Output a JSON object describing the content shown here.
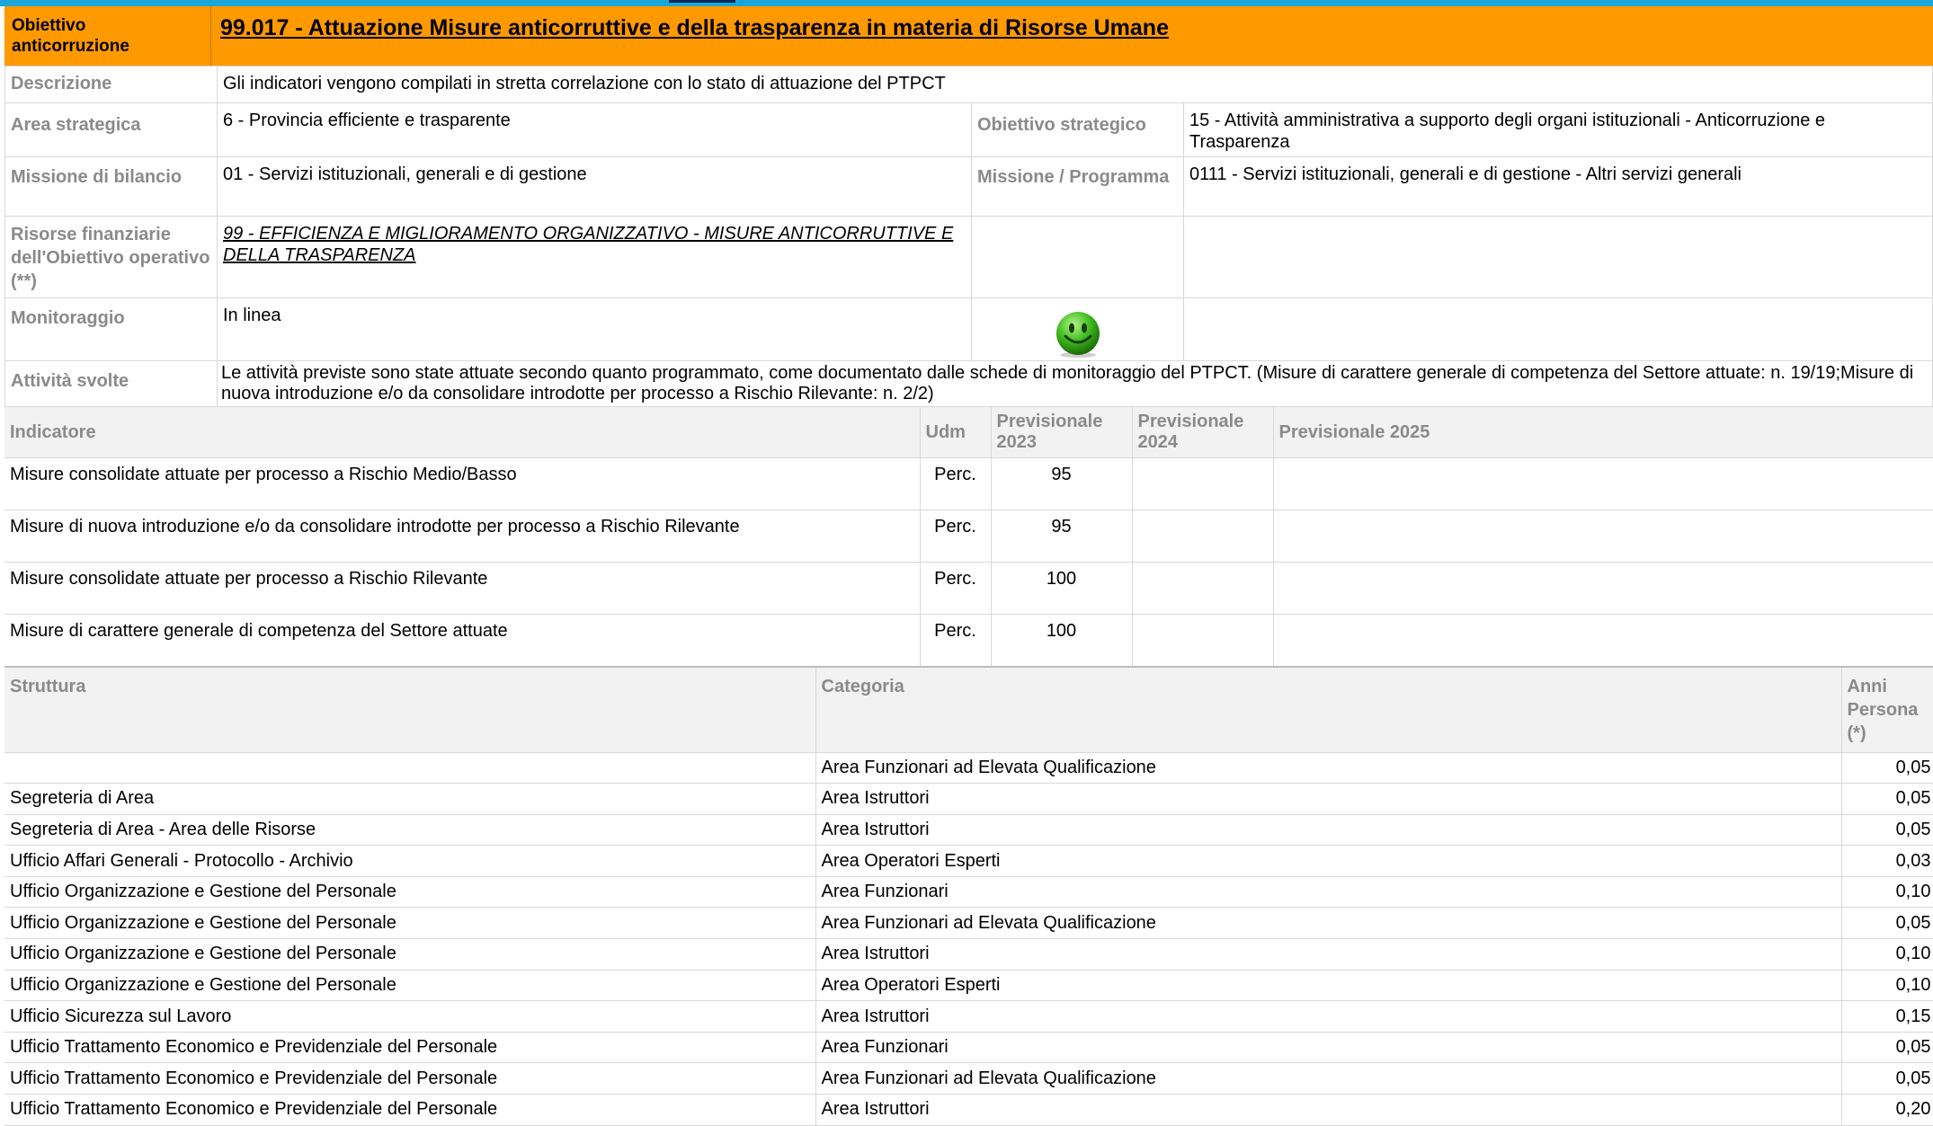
{
  "header": {
    "label": "Obiettivo anticorruzione",
    "title": "99.017 - Attuazione Misure anticorruttive e della trasparenza in materia di Risorse Umane"
  },
  "details": {
    "descrizione_label": "Descrizione",
    "descrizione_value": "Gli indicatori vengono compilati in stretta correlazione con lo stato di attuazione del PTPCT",
    "area_label": "Area strategica",
    "area_value": "6 - Provincia efficiente e trasparente",
    "obiettivo_strategico_label": "Obiettivo strategico",
    "obiettivo_strategico_value": "15 - Attività amministrativa a supporto degli organi istituzionali - Anticorruzione e Trasparenza",
    "missione_label": "Missione di bilancio",
    "missione_value": "01 - Servizi istituzionali, generali e di gestione",
    "missione_programma_label": "Missione / Programma",
    "missione_programma_value": "0111 - Servizi istituzionali, generali e di gestione - Altri servizi generali",
    "risorse_label": "Risorse finanziarie dell'Obiettivo operativo (**)",
    "risorse_value": "99 - EFFICIENZA E MIGLIORAMENTO ORGANIZZATIVO - MISURE ANTICORRUTTIVE E DELLA TRASPARENZA",
    "monitoraggio_label": "Monitoraggio",
    "monitoraggio_value": "In linea",
    "monitoraggio_icon": "smiley-green-icon",
    "attivita_label": "Attività svolte",
    "attivita_value": "Le attività previste sono state attuate secondo quanto programmato, come documentato dalle schede di monitoraggio del PTPCT. (Misure di carattere generale di competenza del Settore attuate: n. 19/19;Misure di nuova introduzione e/o da consolidare introdotte per processo a Rischio Rilevante: n. 2/2)"
  },
  "indicators": {
    "headers": {
      "indicatore": "Indicatore",
      "udm": "Udm",
      "prev2023": "Previsionale 2023",
      "prev2024": "Previsionale 2024",
      "prev2025": "Previsionale 2025"
    },
    "rows": [
      {
        "name": "Misure consolidate attuate per processo a Rischio Medio/Basso",
        "udm": "Perc.",
        "p2023": "95",
        "p2024": "",
        "p2025": ""
      },
      {
        "name": "Misure di nuova introduzione e/o da consolidare introdotte per processo a Rischio Rilevante",
        "udm": "Perc.",
        "p2023": "95",
        "p2024": "",
        "p2025": ""
      },
      {
        "name": "Misure consolidate attuate per processo a Rischio Rilevante",
        "udm": "Perc.",
        "p2023": "100",
        "p2024": "",
        "p2025": ""
      },
      {
        "name": "Misure di carattere generale di competenza del Settore attuate",
        "udm": "Perc.",
        "p2023": "100",
        "p2024": "",
        "p2025": ""
      }
    ]
  },
  "structures": {
    "headers": {
      "struttura": "Struttura",
      "categoria": "Categoria",
      "anni": "Anni Persona (*)"
    },
    "rows": [
      {
        "struttura": "",
        "categoria": "Area Funzionari ad Elevata Qualificazione",
        "anni": "0,05"
      },
      {
        "struttura": "Segreteria di Area",
        "categoria": "Area Istruttori",
        "anni": "0,05"
      },
      {
        "struttura": "Segreteria di Area - Area delle Risorse",
        "categoria": "Area Istruttori",
        "anni": "0,05"
      },
      {
        "struttura": "Ufficio Affari Generali - Protocollo - Archivio",
        "categoria": "Area Operatori Esperti",
        "anni": "0,03"
      },
      {
        "struttura": "Ufficio Organizzazione e Gestione del Personale",
        "categoria": "Area Funzionari",
        "anni": "0,10"
      },
      {
        "struttura": "Ufficio Organizzazione e Gestione del Personale",
        "categoria": "Area Funzionari ad Elevata Qualificazione",
        "anni": "0,05"
      },
      {
        "struttura": "Ufficio Organizzazione e Gestione del Personale",
        "categoria": "Area Istruttori",
        "anni": "0,10"
      },
      {
        "struttura": "Ufficio Organizzazione e Gestione del Personale",
        "categoria": "Area Operatori Esperti",
        "anni": "0,10"
      },
      {
        "struttura": "Ufficio Sicurezza sul Lavoro",
        "categoria": "Area Istruttori",
        "anni": "0,15"
      },
      {
        "struttura": "Ufficio Trattamento Economico e Previdenziale del Personale",
        "categoria": "Area Funzionari",
        "anni": "0,05"
      },
      {
        "struttura": "Ufficio Trattamento Economico e Previdenziale del Personale",
        "categoria": "Area Funzionari ad Elevata Qualificazione",
        "anni": "0,05"
      },
      {
        "struttura": "Ufficio Trattamento Economico e Previdenziale del Personale",
        "categoria": "Area Istruttori",
        "anni": "0,20"
      }
    ]
  }
}
